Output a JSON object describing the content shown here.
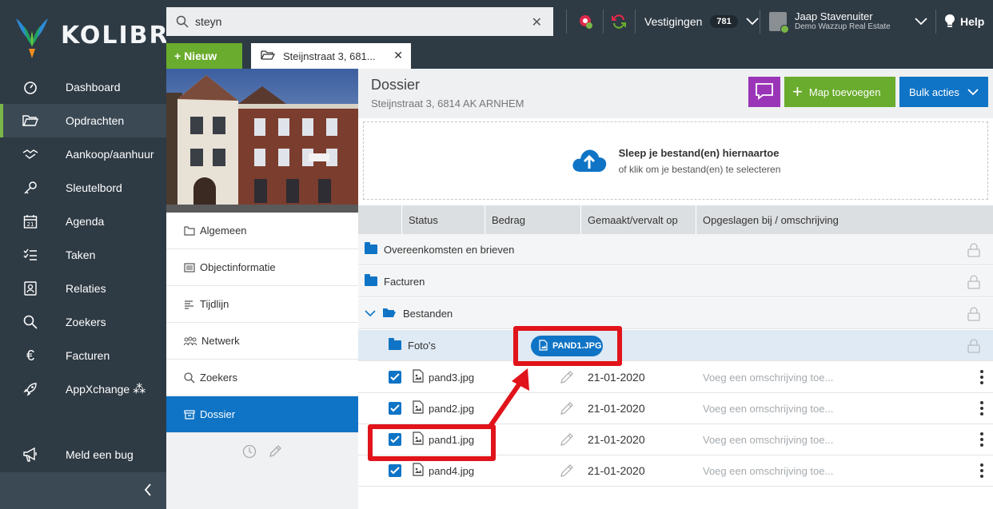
{
  "app": {
    "brand": "KOLIBRI"
  },
  "nav": {
    "items": [
      {
        "label": "Dashboard",
        "icon": "gauge-icon"
      },
      {
        "label": "Opdrachten",
        "icon": "folder-open-icon"
      },
      {
        "label": "Aankoop/aanhuur",
        "icon": "handshake-icon"
      },
      {
        "label": "Sleutelbord",
        "icon": "key-icon"
      },
      {
        "label": "Agenda",
        "icon": "calendar-icon"
      },
      {
        "label": "Taken",
        "icon": "checklist-icon"
      },
      {
        "label": "Relaties",
        "icon": "contact-card-icon"
      },
      {
        "label": "Zoekers",
        "icon": "search-icon"
      },
      {
        "label": "Facturen",
        "icon": "euro-icon"
      },
      {
        "label": "AppXchange",
        "icon": "rocket-icon"
      }
    ],
    "bug": {
      "label": "Meld een bug",
      "icon": "megaphone-icon"
    },
    "active_index": 1
  },
  "topbar": {
    "search": {
      "value": "steyn",
      "placeholder": ""
    },
    "vestigingen": {
      "label": "Vestigingen",
      "count": "781"
    },
    "user": {
      "name": "Jaap Stavenuiter",
      "org": "Demo Wazzup Real Estate"
    },
    "help": "Help"
  },
  "tabs": {
    "new_label": "+ Nieuw",
    "open": [
      {
        "label": "Steijnstraat 3, 681..."
      }
    ]
  },
  "submenu": {
    "items": [
      {
        "label": "Algemeen",
        "icon": "folder-icon"
      },
      {
        "label": "Objectinformatie",
        "icon": "list-icon"
      },
      {
        "label": "Tijdlijn",
        "icon": "timeline-icon"
      },
      {
        "label": "Netwerk",
        "icon": "network-icon"
      },
      {
        "label": "Zoekers",
        "icon": "search-icon"
      },
      {
        "label": "Dossier",
        "icon": "archive-icon"
      }
    ],
    "active_index": 5
  },
  "dossier": {
    "title": "Dossier",
    "address": "Steijnstraat 3, 6814 AK ARNHEM",
    "map_button": "Map toevoegen",
    "bulk_button": "Bulk acties",
    "dropzone": {
      "title": "Sleep je bestand(en) hiernaartoe",
      "subtitle": "of klik om je bestand(en) te selecteren"
    },
    "columns": [
      "Status",
      "Bedrag",
      "Gemaakt/vervalt op",
      "Opgeslagen bij / omschrijving"
    ],
    "folders": [
      {
        "label": "Overeenkomsten en brieven"
      },
      {
        "label": "Facturen"
      },
      {
        "label": "Bestanden"
      },
      {
        "label": "Foto's"
      }
    ],
    "files": [
      {
        "name": "pand3.jpg",
        "date": "21-01-2020",
        "desc": "Voeg een omschrijving toe..."
      },
      {
        "name": "pand2.jpg",
        "date": "21-01-2020",
        "desc": "Voeg een omschrijving toe..."
      },
      {
        "name": "pand1.jpg",
        "date": "21-01-2020",
        "desc": "Voeg een omschrijving toe..."
      },
      {
        "name": "pand4.jpg",
        "date": "21-01-2020",
        "desc": "Voeg een omschrijving toe..."
      }
    ],
    "drag_chip": "PAND1.JPG"
  },
  "colors": {
    "sidebar": "#2e3a44",
    "green": "#6aac2d",
    "blue": "#0f74c5",
    "purple": "#9b35b7",
    "annotation_red": "#e0141a"
  }
}
